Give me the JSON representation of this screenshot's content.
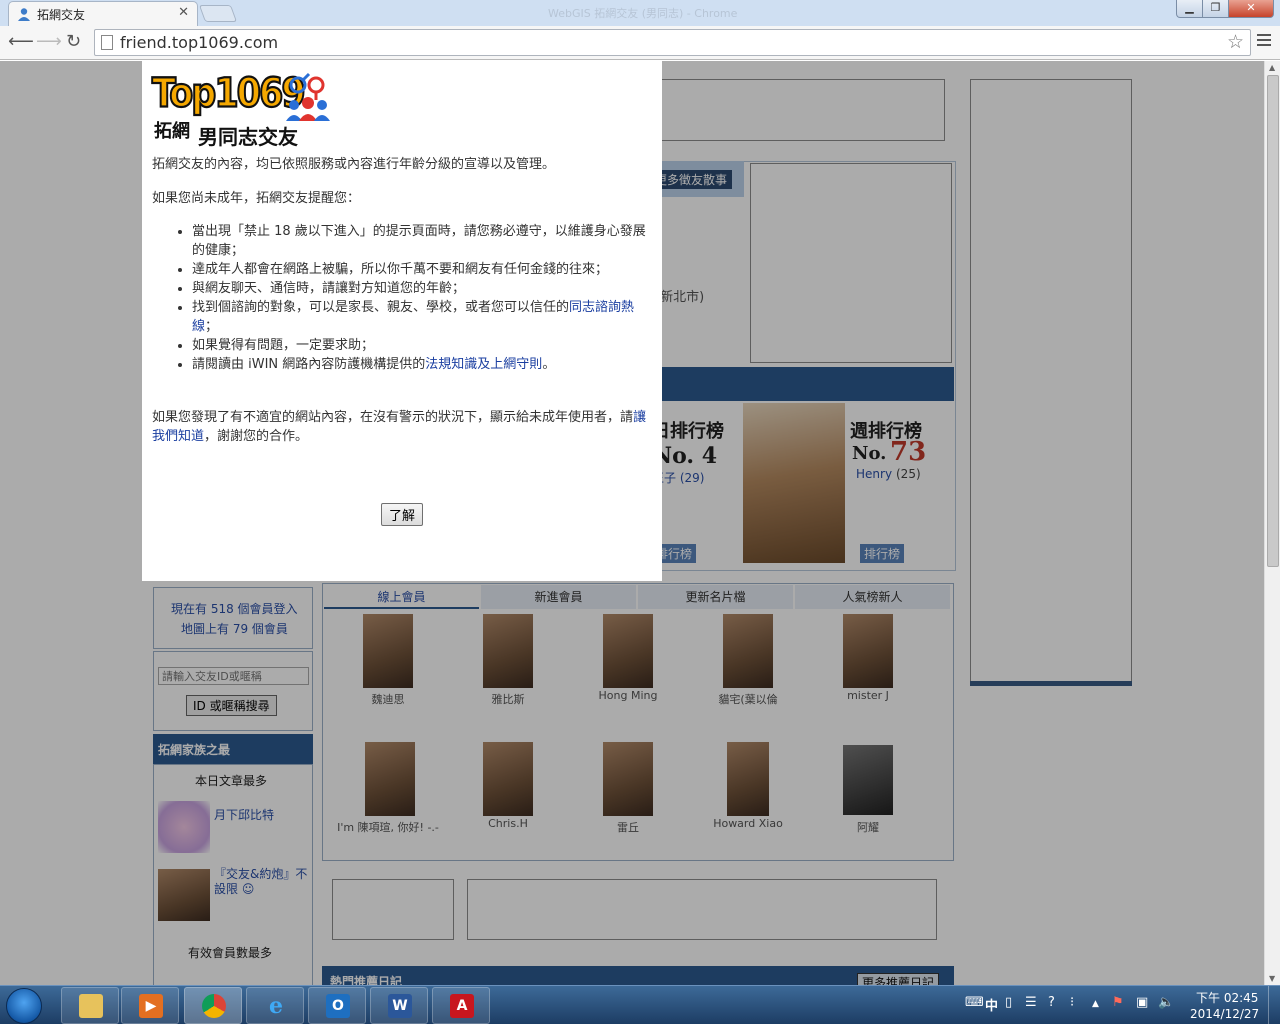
{
  "browser": {
    "tab_title": "拓網交友",
    "window_title": "WebGIS 拓網交友 (男同志) - Chrome",
    "url": "friend.top1069.com"
  },
  "background": {
    "story_button": "更多徵友散事",
    "location_fragment": "(新北市)",
    "rank_daily_title": "日排行榜",
    "rank_daily_no": "No. 4",
    "rank_daily_name": "王子 (29)",
    "rank_weekly_title": "週排行榜",
    "rank_weekly_no_label": "No.",
    "rank_weekly_no": "73",
    "rank_weekly_name": "Henry",
    "rank_weekly_age": "(25)",
    "rank_button": "排行榜",
    "online_line1": "現在有 518 個會員登入",
    "online_line2": "地圖上有 79 個會員",
    "search_placeholder": "請輸入交友ID或暱稱",
    "search_button": "ID 或暱稱搜尋",
    "family_header": "拓網家族之最",
    "most_articles": "本日文章最多",
    "family1": "月下邱比特",
    "family2": "『交友&約炮』不設限 ☺",
    "most_members": "有效會員數最多",
    "tabs": [
      "線上會員",
      "新進會員",
      "更新名片檔",
      "人氣榜新人"
    ],
    "members_row1": [
      "魏迪思",
      "雅比斯",
      "Hong Ming",
      "貓宅(葉以倫",
      "mister J"
    ],
    "members_row2": [
      "I'm 陳項瑄, 你好! -.-",
      "Chris.H",
      "雷丘",
      "Howard Xiao",
      "阿耀"
    ],
    "diary_header": "熱門推薦日記",
    "diary_more": "更多推薦日記"
  },
  "modal": {
    "logo_top": "Top1069",
    "logo_sub1": "拓網",
    "logo_sub2": "男同志交友",
    "p1": "拓網交友的內容，均已依照服務或內容進行年齡分級的宣導以及管理。",
    "p2": "如果您尚未成年，拓網交友提醒您：",
    "li1": "當出現「禁止 18 歲以下進入」的提示頁面時，請您務必遵守，以維護身心發展的健康；",
    "li2": "達成年人都會在網路上被騙，所以你千萬不要和網友有任何金錢的往來；",
    "li3": "與網友聊天、通信時，請讓對方知道您的年齡；",
    "li4_pre": "找到個諮詢的對象，可以是家長、親友、學校，或者您可以信任的",
    "li4_link": "同志諮詢熱線",
    "li4_post": "；",
    "li5": "如果覺得有問題，一定要求助；",
    "li6_pre": "請閱讀由 iWIN 網路內容防護機構提供的",
    "li6_link": "法規知識及上網守則",
    "li6_post": "。",
    "p3_pre": "如果您發現了有不適宜的網站內容，在沒有警示的狀況下，顯示給未成年使用者，請",
    "p3_link": "讓我們知道",
    "p3_post": "，謝謝您的合作。",
    "ok_label": "了解"
  },
  "taskbar": {
    "clock_time": "下午 02:45",
    "clock_date": "2014/12/27",
    "ime": "中"
  },
  "colors": {
    "overlay": "#000000",
    "link": "#1a3ea0",
    "rank_red": "#c0392b",
    "logo_orange": "#f5a800"
  }
}
